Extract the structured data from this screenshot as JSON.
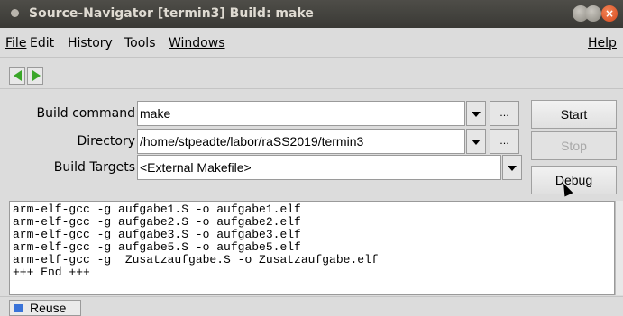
{
  "window": {
    "title": "Source-Navigator [termin3] Build: make"
  },
  "menu": {
    "file": "File",
    "edit": "Edit",
    "history": "History",
    "tools": "Tools",
    "windows": "Windows",
    "help": "Help"
  },
  "nav": {
    "back_icon": "left-arrow-icon",
    "forward_icon": "right-arrow-icon",
    "accent": "#3aa628"
  },
  "form": {
    "build_command_label": "Build command",
    "build_command_value": "make",
    "directory_label": "Directory",
    "directory_value": "/home/stpeadte/labor/raSS2019/termin3",
    "build_targets_label": "Build Targets",
    "build_targets_value": "<External Makefile>",
    "browse_label": "..."
  },
  "actions": {
    "start": "Start",
    "stop": "Stop",
    "debug": "Debug"
  },
  "output": {
    "lines": [
      "arm-elf-gcc -g aufgabe1.S -o aufgabe1.elf",
      "arm-elf-gcc -g aufgabe2.S -o aufgabe2.elf",
      "arm-elf-gcc -g aufgabe3.S -o aufgabe3.elf",
      "arm-elf-gcc -g aufgabe5.S -o aufgabe5.elf",
      "arm-elf-gcc -g  Zusatzaufgabe.S -o Zusatzaufgabe.elf",
      "+++ End +++"
    ]
  },
  "status": {
    "reuse_label": "Reuse",
    "reuse_checked": true
  }
}
